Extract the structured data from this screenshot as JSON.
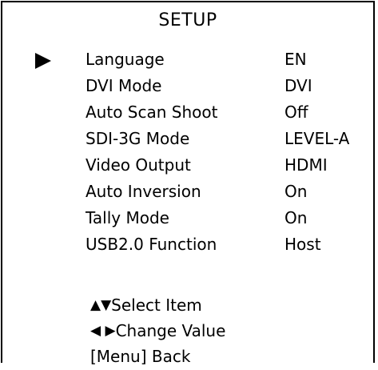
{
  "title": "SETUP",
  "cursor_icon": "triangle-right-icon",
  "items": [
    {
      "label": "Language",
      "value": "EN"
    },
    {
      "label": "DVI Mode",
      "value": "DVI"
    },
    {
      "label": "Auto Scan Shoot",
      "value": "Off"
    },
    {
      "label": "SDI-3G Mode",
      "value": "LEVEL-A"
    },
    {
      "label": "Video Output",
      "value": "HDMI"
    },
    {
      "label": "Auto Inversion",
      "value": "On"
    },
    {
      "label": "Tally Mode",
      "value": "On"
    },
    {
      "label": "USB2.0 Function",
      "value": "Host"
    }
  ],
  "hints": {
    "select_glyphs": "▲▼",
    "select_text": "Select Item",
    "change_glyphs": "◀ ▶",
    "change_text": "Change Value",
    "back_text": "[Menu] Back"
  },
  "colors": {
    "background": "#ffffff",
    "text": "#000000",
    "border": "#000000"
  }
}
